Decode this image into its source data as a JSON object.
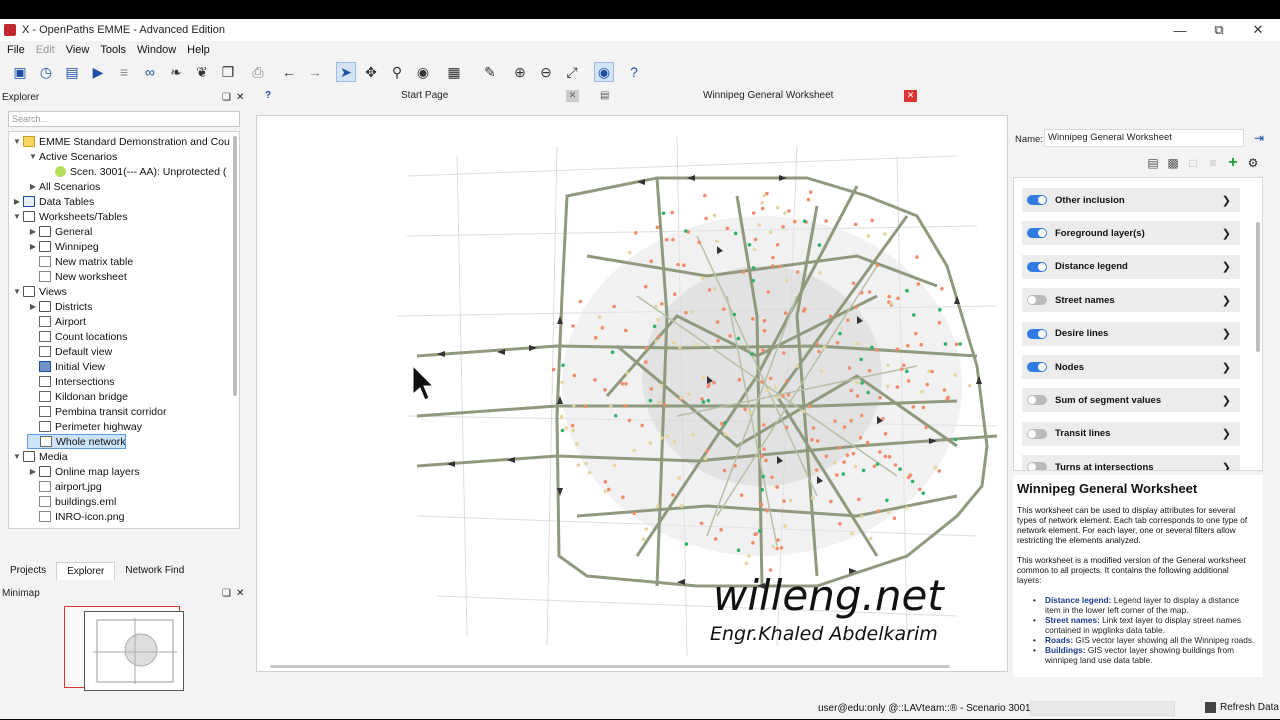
{
  "window": {
    "title": "X - OpenPaths EMME - Advanced Edition"
  },
  "menu": [
    "File",
    "Edit",
    "View",
    "Tools",
    "Window",
    "Help"
  ],
  "explorer": {
    "title": "Explorer",
    "search_placeholder": "Search...",
    "tree": [
      {
        "label": "EMME Standard Demonstration and Cou",
        "level": 0,
        "expanded": true,
        "icon": "folder-y"
      },
      {
        "label": "Active Scenarios",
        "level": 1,
        "expanded": true,
        "icon": "none"
      },
      {
        "label": "Scen. 3001(--- AA): Unprotected (",
        "level": 2,
        "icon": "dot"
      },
      {
        "label": "All Scenarios",
        "level": 1,
        "expanded": false,
        "icon": "none"
      },
      {
        "label": "Data Tables",
        "level": 0,
        "expanded": false,
        "icon": "table"
      },
      {
        "label": "Worksheets/Tables",
        "level": 0,
        "expanded": true,
        "icon": "folder"
      },
      {
        "label": "General",
        "level": 1,
        "expanded": false,
        "icon": "folder"
      },
      {
        "label": "Winnipeg",
        "level": 1,
        "expanded": false,
        "icon": "folder"
      },
      {
        "label": "New matrix table",
        "level": 1,
        "icon": "file"
      },
      {
        "label": "New worksheet",
        "level": 1,
        "icon": "file"
      },
      {
        "label": "Views",
        "level": 0,
        "expanded": true,
        "icon": "folder"
      },
      {
        "label": "Districts",
        "level": 1,
        "expanded": false,
        "icon": "folder"
      },
      {
        "label": "Airport",
        "level": 1,
        "icon": "view"
      },
      {
        "label": "Count locations",
        "level": 1,
        "icon": "view"
      },
      {
        "label": "Default view",
        "level": 1,
        "icon": "view"
      },
      {
        "label": "Initial View",
        "level": 1,
        "icon": "viewb"
      },
      {
        "label": "Intersections",
        "level": 1,
        "icon": "view"
      },
      {
        "label": "Kildonan bridge",
        "level": 1,
        "icon": "view"
      },
      {
        "label": "Pembina transit corridor",
        "level": 1,
        "icon": "view"
      },
      {
        "label": "Perimeter highway",
        "level": 1,
        "icon": "view"
      },
      {
        "label": "Whole network",
        "level": 1,
        "icon": "view",
        "selected": true
      },
      {
        "label": "Media",
        "level": 0,
        "expanded": true,
        "icon": "folder"
      },
      {
        "label": "Online map layers",
        "level": 1,
        "expanded": false,
        "icon": "folder"
      },
      {
        "label": "airport.jpg",
        "level": 1,
        "icon": "file"
      },
      {
        "label": "buildings.eml",
        "level": 1,
        "icon": "file"
      },
      {
        "label": "INRO-icon.png",
        "level": 1,
        "icon": "file"
      }
    ]
  },
  "panel_tabs": [
    "Projects",
    "Explorer",
    "Network Find"
  ],
  "minimap": {
    "title": "Minimap"
  },
  "doc_tabs": {
    "start": "Start Page",
    "worksheet": "Winnipeg General Worksheet"
  },
  "right": {
    "name_label": "Name:",
    "name_value": "Winnipeg General Worksheet",
    "layers": [
      {
        "name": "Other inclusion",
        "on": true
      },
      {
        "name": "Foreground layer(s)",
        "on": true
      },
      {
        "name": "Distance legend",
        "on": true
      },
      {
        "name": "Street names",
        "on": false
      },
      {
        "name": "Desire lines",
        "on": true
      },
      {
        "name": "Nodes",
        "on": true
      },
      {
        "name": "Sum of segment values",
        "on": false
      },
      {
        "name": "Transit lines",
        "on": false
      },
      {
        "name": "Turns at intersections",
        "on": false
      }
    ],
    "desc_title": "Winnipeg General Worksheet",
    "desc_p1": "This worksheet can be used to display attributes for several types of network element. Each tab corresponds to one type of network element. For each layer, one or several filters allow restricting the elements analyzed.",
    "desc_p2": "This worksheet is a modified version of the General worksheet common to all projects. It contains the following additional layers:",
    "desc_items": [
      {
        "k": "Distance legend:",
        "v": " Legend layer to display a distance item in the lower left corner of the map."
      },
      {
        "k": "Street names:",
        "v": " Link text layer to display street names contained in wpglinks data table."
      },
      {
        "k": "Roads:",
        "v": " GIS vector layer showing all the Winnipeg roads."
      },
      {
        "k": "Buildings:",
        "v": " GIS vector layer showing buildings from winnipeg land use data table."
      }
    ]
  },
  "watermark": {
    "line1": "willeng.net",
    "line2": "Engr.Khaled Abdelkarim"
  },
  "status": {
    "text": "user@edu:only @::LAVteam::® - Scenario 3001",
    "refresh": "Refresh Data"
  }
}
